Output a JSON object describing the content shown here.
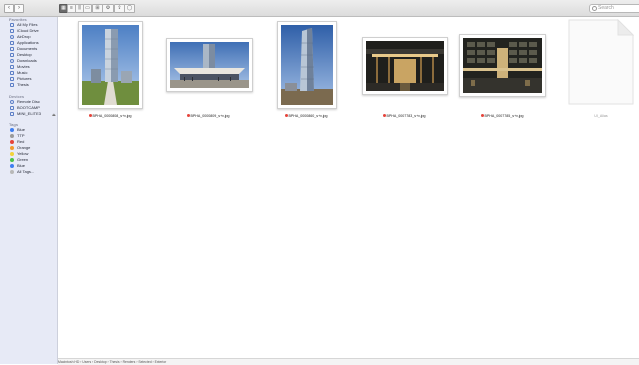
{
  "window": {
    "search_placeholder": "Search"
  },
  "toolbar": {
    "back": "‹",
    "forward": "›"
  },
  "sidebar": {
    "favorites_header": "Favorites",
    "favorites": [
      "All My Files",
      "iCloud Drive",
      "AirDrop",
      "Applications",
      "Documents",
      "Desktop",
      "Downloads",
      "Movies",
      "Music",
      "Pictures",
      "Thesis"
    ],
    "devices_header": "Devices",
    "devices": [
      "Remote Disc",
      "BOOTCAMP",
      "MINI_ELITE3"
    ],
    "tags_header": "Tags",
    "tags": [
      {
        "label": "Blue",
        "color": "#3f7ff0"
      },
      {
        "label": "TTP",
        "color": "#9a9a9a"
      },
      {
        "label": "Red",
        "color": "#e5443b"
      },
      {
        "label": "Orange",
        "color": "#f29a2e"
      },
      {
        "label": "Yellow",
        "color": "#f2d33a"
      },
      {
        "label": "Green",
        "color": "#4cc24a"
      },
      {
        "label": "Blue",
        "color": "#3f7ff0"
      },
      {
        "label": "All Tags...",
        "color": "#b8b8b8"
      }
    ]
  },
  "files": [
    {
      "name": "BPHA_0000808_s+v.jpg",
      "tag_color": "#e5443b"
    },
    {
      "name": "BPHA_0000809_s+v.jpg",
      "tag_color": "#e5443b"
    },
    {
      "name": "BPHA_0000860_s+v.jpg",
      "tag_color": "#e5443b"
    },
    {
      "name": "BPHA_0007783_s+v.jpg",
      "tag_color": "#e5443b"
    },
    {
      "name": "BPHA_0007785_s+v.jpg",
      "tag_color": "#e5443b"
    },
    {
      "name": "UI_Alias",
      "tag_color": ""
    }
  ],
  "pathbar": {
    "text": "Macintosh HD  ›  Users  ›  Desktop  ›  Thesis  ›  Renders  ›  Selected  ›  Exterior"
  }
}
